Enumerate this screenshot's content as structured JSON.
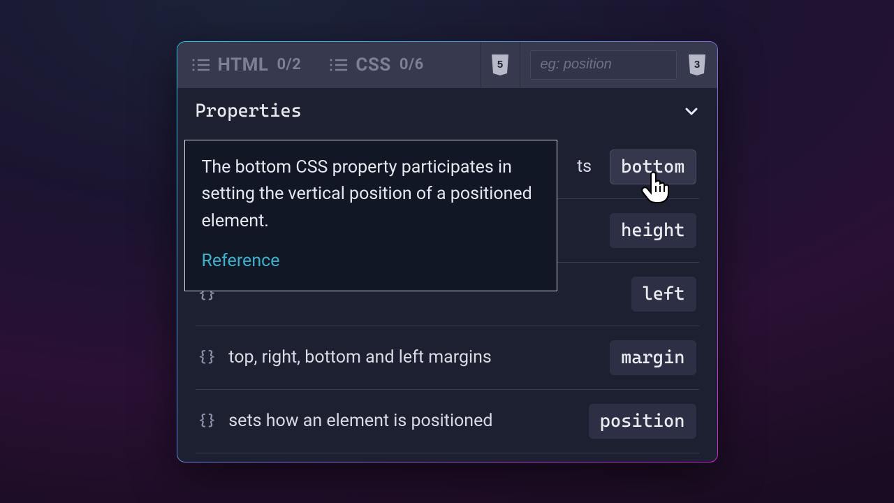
{
  "tabs": {
    "html": {
      "label": "HTML",
      "count": "0/2"
    },
    "css": {
      "label": "CSS",
      "count": "0/6"
    }
  },
  "search": {
    "placeholder": "eg: position"
  },
  "section": {
    "title": "Properties"
  },
  "tooltip": {
    "text": "The bottom CSS property participates in setting the vertical position of a positioned element.",
    "reference_label": "Reference"
  },
  "partial_row_fragment": "ts",
  "rows": [
    {
      "chip": "bottom",
      "desc": ""
    },
    {
      "chip": "height",
      "desc": ""
    },
    {
      "chip": "left",
      "desc": ""
    },
    {
      "chip": "margin",
      "desc": "top, right, bottom and left margins"
    },
    {
      "chip": "position",
      "desc": "sets how an element is positioned"
    }
  ],
  "icons": {
    "html_badge": "5",
    "css_badge": "3"
  }
}
